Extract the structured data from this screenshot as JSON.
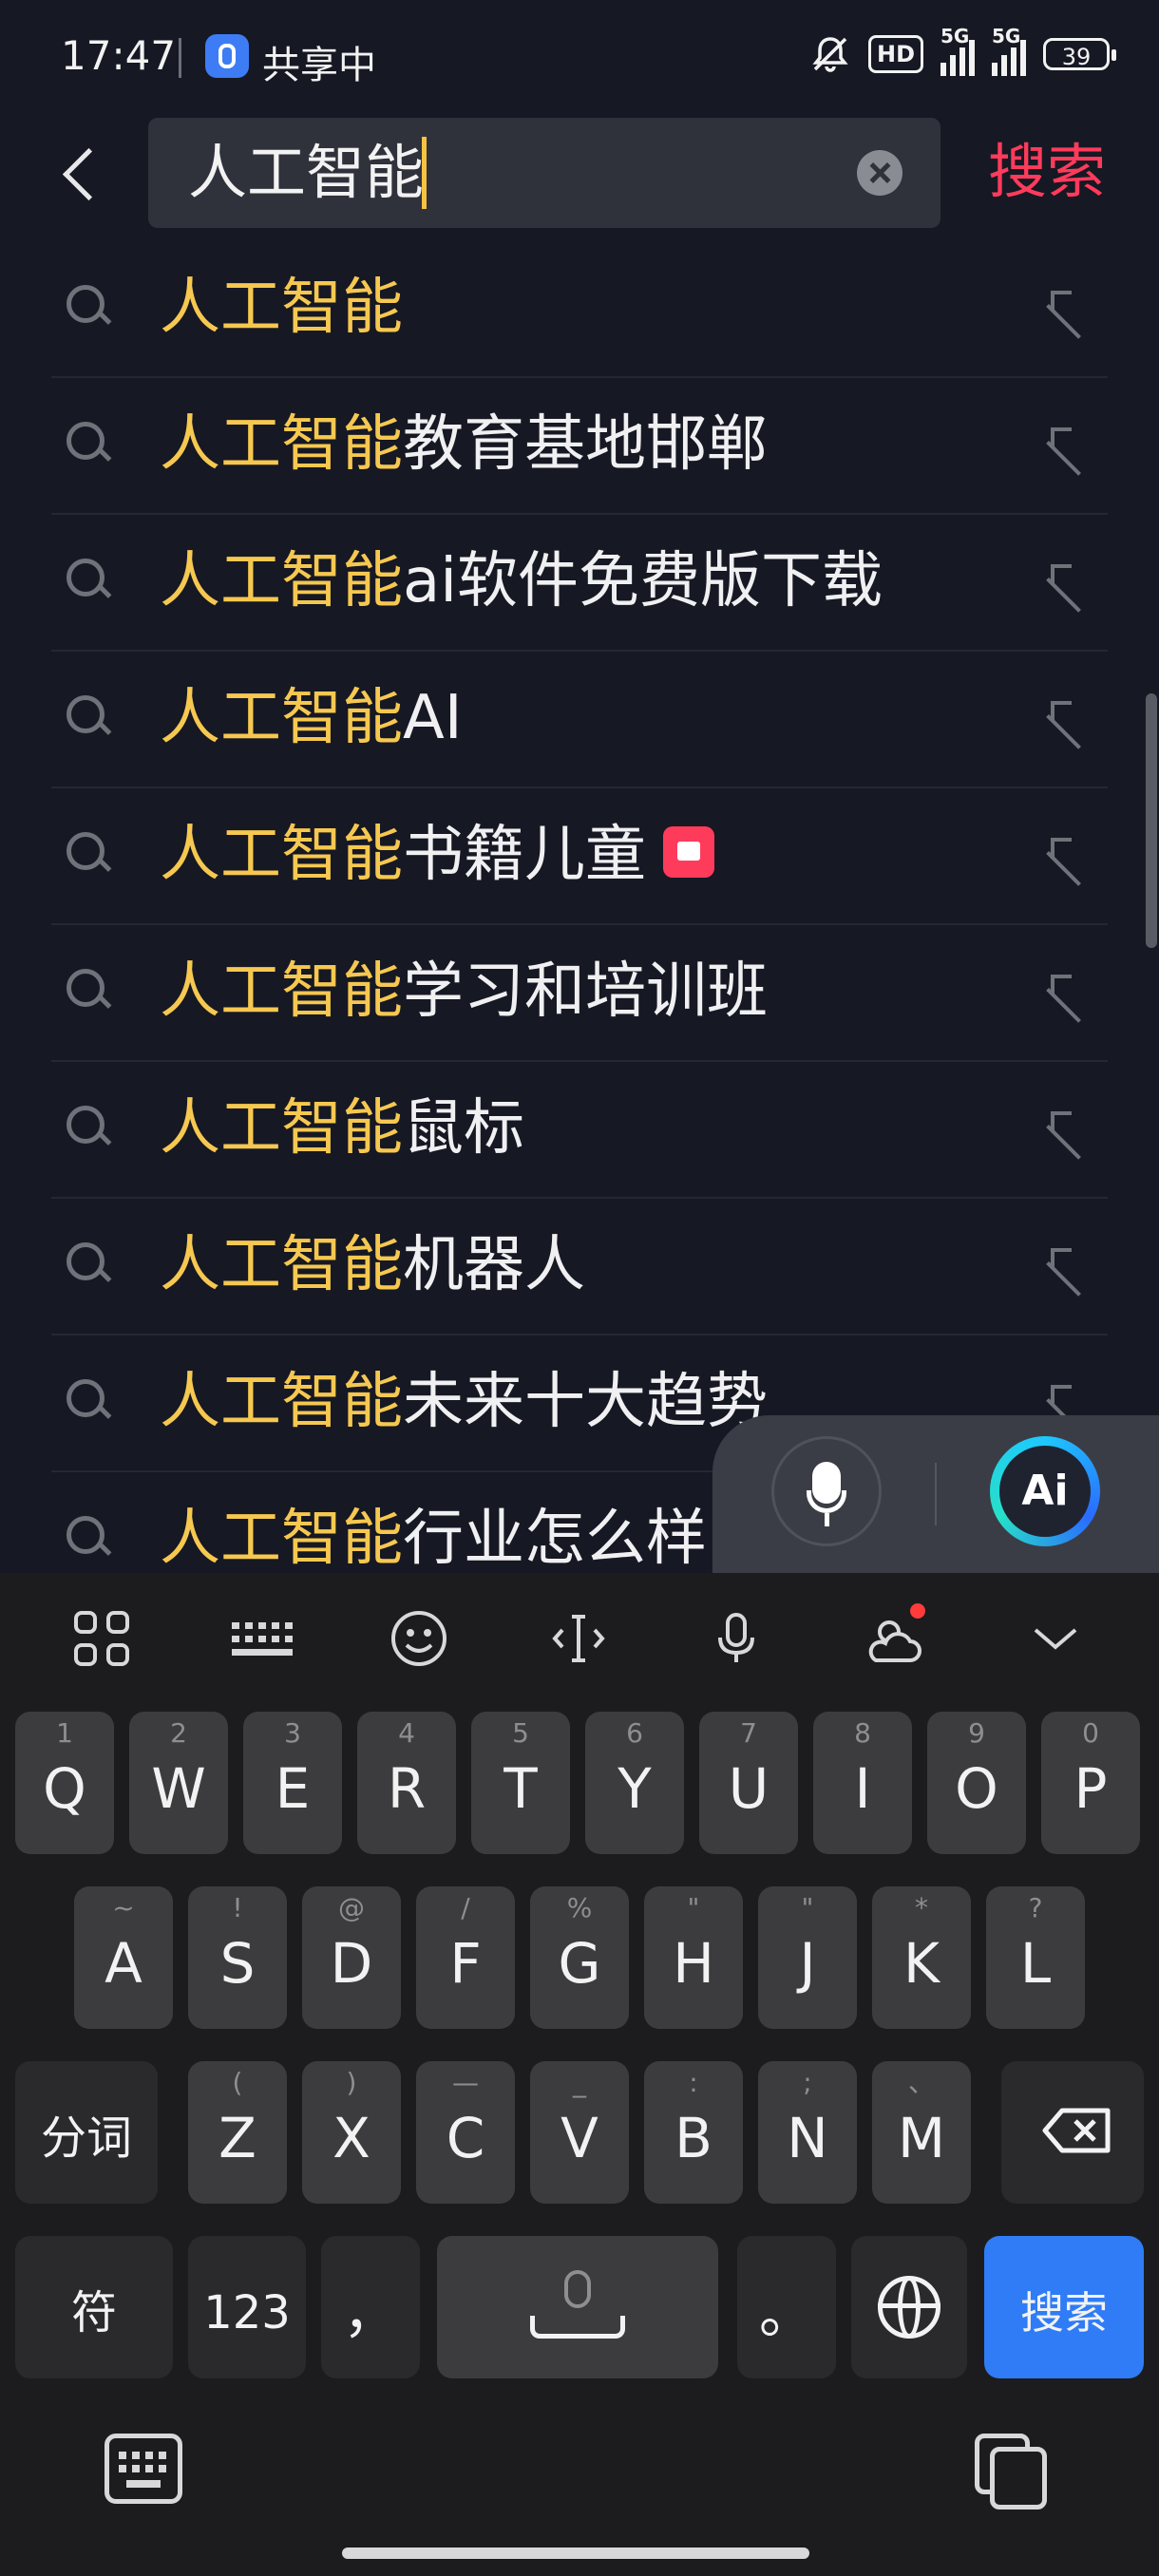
{
  "status_bar": {
    "time": "17:47",
    "share_label": "共享中",
    "hd_label": "HD",
    "signal1_label": "5G",
    "signal2_label": "5G",
    "battery": "39"
  },
  "search": {
    "query": "人工智能",
    "submit_label": "搜索"
  },
  "suggestions": [
    {
      "highlight": "人工智能",
      "rest": ""
    },
    {
      "highlight": "人工智能",
      "rest": "教育基地邯郸"
    },
    {
      "highlight": "人工智能",
      "rest": "ai软件免费版下载"
    },
    {
      "highlight": "人工智能",
      "rest": "AI"
    },
    {
      "highlight": "人工智能",
      "rest": "书籍儿童",
      "badge": true
    },
    {
      "highlight": "人工智能",
      "rest": "学习和培训班"
    },
    {
      "highlight": "人工智能",
      "rest": "鼠标"
    },
    {
      "highlight": "人工智能",
      "rest": "机器人"
    },
    {
      "highlight": "人工智能",
      "rest": "未来十大趋势"
    },
    {
      "highlight": "人工智能",
      "rest": "行业怎么样"
    }
  ],
  "floating": {
    "ai_label": "Ai"
  },
  "keyboard": {
    "row1": [
      {
        "label": "Q",
        "sub": "1"
      },
      {
        "label": "W",
        "sub": "2"
      },
      {
        "label": "E",
        "sub": "3"
      },
      {
        "label": "R",
        "sub": "4"
      },
      {
        "label": "T",
        "sub": "5"
      },
      {
        "label": "Y",
        "sub": "6"
      },
      {
        "label": "U",
        "sub": "7"
      },
      {
        "label": "I",
        "sub": "8"
      },
      {
        "label": "O",
        "sub": "9"
      },
      {
        "label": "P",
        "sub": "0"
      }
    ],
    "row2": [
      {
        "label": "A",
        "sub": "~"
      },
      {
        "label": "S",
        "sub": "!"
      },
      {
        "label": "D",
        "sub": "@"
      },
      {
        "label": "F",
        "sub": "/"
      },
      {
        "label": "G",
        "sub": "%"
      },
      {
        "label": "H",
        "sub": "\""
      },
      {
        "label": "J",
        "sub": "\""
      },
      {
        "label": "K",
        "sub": "*"
      },
      {
        "label": "L",
        "sub": "?"
      }
    ],
    "row3": [
      {
        "label": "Z",
        "sub": "("
      },
      {
        "label": "X",
        "sub": ")"
      },
      {
        "label": "C",
        "sub": "—"
      },
      {
        "label": "V",
        "sub": "_"
      },
      {
        "label": "B",
        "sub": ":"
      },
      {
        "label": "N",
        "sub": ";"
      },
      {
        "label": "M",
        "sub": "、"
      }
    ],
    "segment_label": "分词",
    "symbol_label": "符",
    "numeric_label": "123",
    "comma_label": "，",
    "period_label": "。",
    "enter_label": "搜索"
  }
}
